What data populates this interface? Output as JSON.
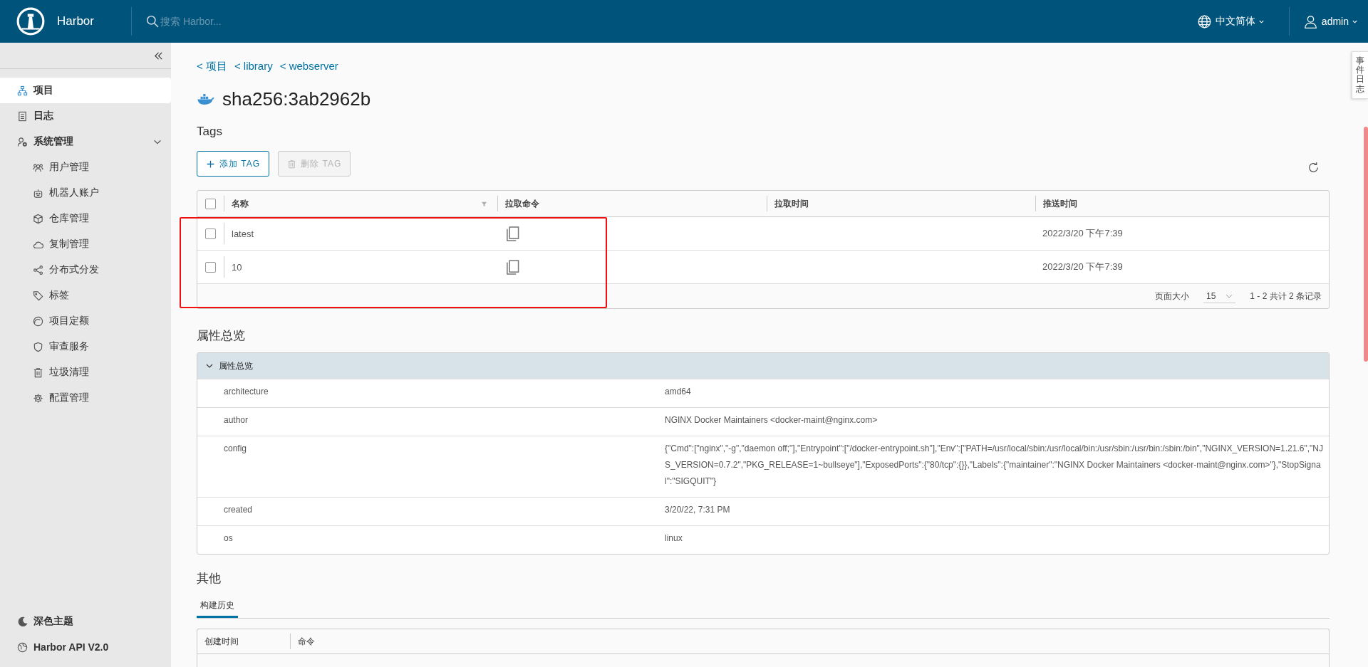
{
  "header": {
    "brand": "Harbor",
    "search": {
      "placeholder": "搜索 Harbor..."
    },
    "language": "中文简体",
    "user": "admin"
  },
  "sidebar": {
    "items": [
      {
        "label": "项目",
        "selected": true
      },
      {
        "label": "日志",
        "selected": false
      },
      {
        "label": "系统管理",
        "selected": false,
        "expanded": true,
        "children": [
          {
            "label": "用户管理",
            "selected": false
          },
          {
            "label": "机器人账户",
            "selected": false
          },
          {
            "label": "仓库管理",
            "selected": false
          },
          {
            "label": "复制管理",
            "selected": false
          },
          {
            "label": "分布式分发",
            "selected": false
          },
          {
            "label": "标签",
            "selected": false
          },
          {
            "label": "项目定额",
            "selected": false
          },
          {
            "label": "审查服务",
            "selected": false
          },
          {
            "label": "垃圾清理",
            "selected": false
          },
          {
            "label": "配置管理",
            "selected": false
          }
        ]
      }
    ],
    "footer": [
      {
        "label": "深色主题"
      },
      {
        "label": "Harbor API V2.0"
      }
    ]
  },
  "breadcrumb": [
    "< 项目",
    "< library",
    "< webserver"
  ],
  "title": "sha256:3ab2962b",
  "tags": {
    "heading": "Tags",
    "buttons": [
      {
        "label": "添加 TAG",
        "disabled": false
      },
      {
        "label": "删除 TAG",
        "disabled": true
      }
    ],
    "select_all_checked": false,
    "columns": [
      "名称",
      "拉取命令",
      "拉取时间",
      "推送时间"
    ],
    "rows": [
      {
        "name": "latest",
        "checked": false,
        "push_time": "2022/3/20 下午7:39"
      },
      {
        "name": "10",
        "checked": false,
        "push_time": "2022/3/20 下午7:39"
      }
    ],
    "page_size_label": "页面大小",
    "page_size": "15",
    "summary": "1 - 2 共计 2 条记录"
  },
  "markup": [
    {
      "kind": "rectangle"
    }
  ],
  "properties": {
    "heading": "属性总览",
    "panel_title": "属性总览",
    "expanded": true,
    "rows": [
      {
        "key": "architecture",
        "value": "amd64"
      },
      {
        "key": "author",
        "value": "NGINX Docker Maintainers <docker-maint@nginx.com>"
      },
      {
        "key": "config",
        "value": "{\"Cmd\":[\"nginx\",\"-g\",\"daemon off;\"],\"Entrypoint\":[\"/docker-entrypoint.sh\"],\"Env\":[\"PATH=/usr/local/sbin:/usr/local/bin:/usr/sbin:/usr/bin:/sbin:/bin\",\"NGINX_VERSION=1.21.6\",\"NJS_VERSION=0.7.2\",\"PKG_RELEASE=1~bullseye\"],\"ExposedPorts\":{\"80/tcp\":{}},\"Labels\":{\"maintainer\":\"NGINX Docker Maintainers <docker-maint@nginx.com>\"},\"StopSignal\":\"SIGQUIT\"}"
      },
      {
        "key": "created",
        "value": "3/20/22, 7:31 PM"
      },
      {
        "key": "os",
        "value": "linux"
      }
    ]
  },
  "other": {
    "heading": "其他",
    "tabs": [
      {
        "label": "构建历史",
        "selected": true
      }
    ],
    "columns": [
      "创建时间",
      "命令"
    ]
  },
  "event_log_tab": "事件日志"
}
